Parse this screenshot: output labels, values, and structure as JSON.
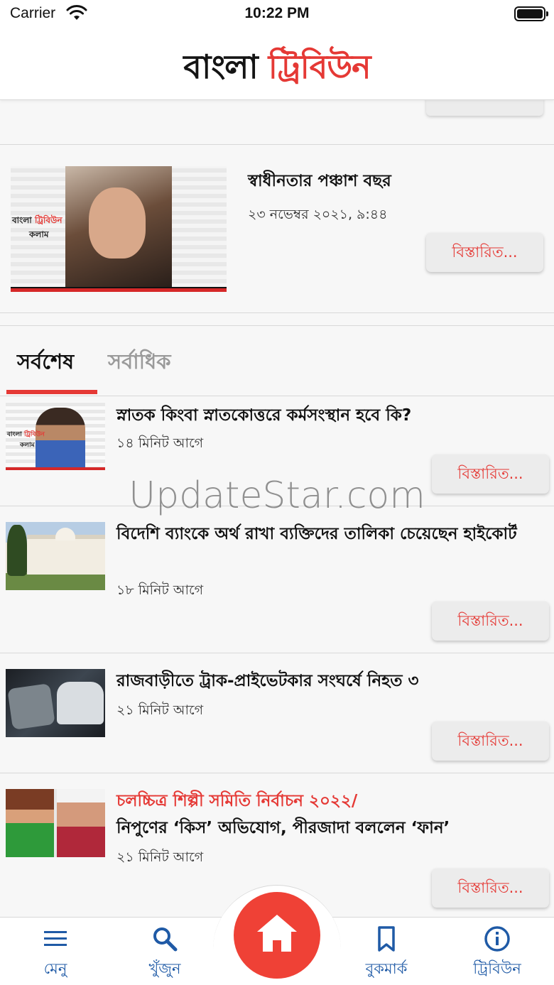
{
  "status_bar": {
    "carrier": "Carrier",
    "time": "10:22 PM"
  },
  "header": {
    "logo_black": "বাংলা",
    "logo_red": "ট্রিবিউন"
  },
  "feature": {
    "title": "স্বাধীনতার পঞ্চাশ বছর",
    "date": "২৩ নভেম্বর ২০২১, ৯:৪৪",
    "thumb_brand_black": "বাংলা",
    "thumb_brand_red": "ট্রিবিউন",
    "thumb_brand_sub": "কলাম",
    "more_label": "বিস্তারিত..."
  },
  "tabs": [
    {
      "label": "সর্বশেষ"
    },
    {
      "label": "সর্বাধিক"
    }
  ],
  "news": [
    {
      "kicker": "",
      "title": "স্নাতক কিংবা স্নাতকোত্তরে কর্মসংস্থান হবে কি?",
      "time": "১৪ মিনিট আগে",
      "more_label": "বিস্তারিত..."
    },
    {
      "kicker": "",
      "title": "বিদেশি ব্যাংকে অর্থ রাখা ব্যক্তিদের তালিকা চেয়েছেন হাইকোর্ট",
      "time": "১৮ মিনিট আগে",
      "more_label": "বিস্তারিত..."
    },
    {
      "kicker": "",
      "title": "রাজবাড়ীতে ট্রাক-প্রাইভেটকার সংঘর্ষে নিহত ৩",
      "time": "২১ মিনিট আগে",
      "more_label": "বিস্তারিত..."
    },
    {
      "kicker": "চলচ্চিত্র শিল্পী সমিতি নির্বাচন ২০২২/",
      "title": "নিপুণের ‘কিস’ অভিযোগ, পীরজাদা বললেন ‘ফান’",
      "time": "২১ মিনিট আগে",
      "more_label": "বিস্তারিত..."
    }
  ],
  "thumb1_brand_black": "বাংলা",
  "thumb1_brand_red": "ট্রিবিউন",
  "thumb1_brand_sub": "কলাম",
  "watermark": "UpdateStar.com",
  "tabbar": {
    "menu": "মেনু",
    "search": "খুঁজুন",
    "bookmark": "বুকমার্ক",
    "tribune": "ট্রিবিউন"
  },
  "colors": {
    "accent": "#e53935",
    "nav": "#1f5aa6",
    "home": "#ef4136"
  },
  "icons": [
    "wifi-icon",
    "battery-icon",
    "menu-icon",
    "search-icon",
    "home-icon",
    "bookmark-icon",
    "info-icon"
  ]
}
